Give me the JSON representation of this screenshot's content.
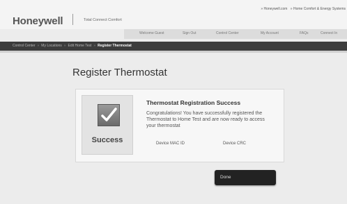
{
  "header": {
    "logo": "Honeywell",
    "tagline": "Total Connect Comfort",
    "top_links": [
      "» Honeywell.com",
      "» Home Comfort & Energy Systems"
    ]
  },
  "primary_nav": {
    "items": [
      "Welcome Guest",
      "Sign Out",
      "Control Center",
      "My Account",
      "FAQs",
      "Connect In"
    ]
  },
  "breadcrumb": {
    "items": [
      "Control Center",
      "My Locations",
      "Edit Home Test"
    ],
    "current": "Register Thermostat"
  },
  "main": {
    "page_title": "Register Thermostat",
    "success_label": "Success",
    "card_title": "Thermostat Registration Success",
    "card_message": "Congratulations! You have successfully registered the Thermostat to Home Test and are now ready to access your thermostat",
    "device_mac_label": "Device MAC ID",
    "device_crc_label": "Device CRC",
    "done_label": "Done"
  },
  "icons": {
    "success": "check-icon"
  },
  "colors": {
    "breadcrumb_bar": "#3c3c3c",
    "done_button": "#222222",
    "check_box": "#7a7a7a"
  }
}
